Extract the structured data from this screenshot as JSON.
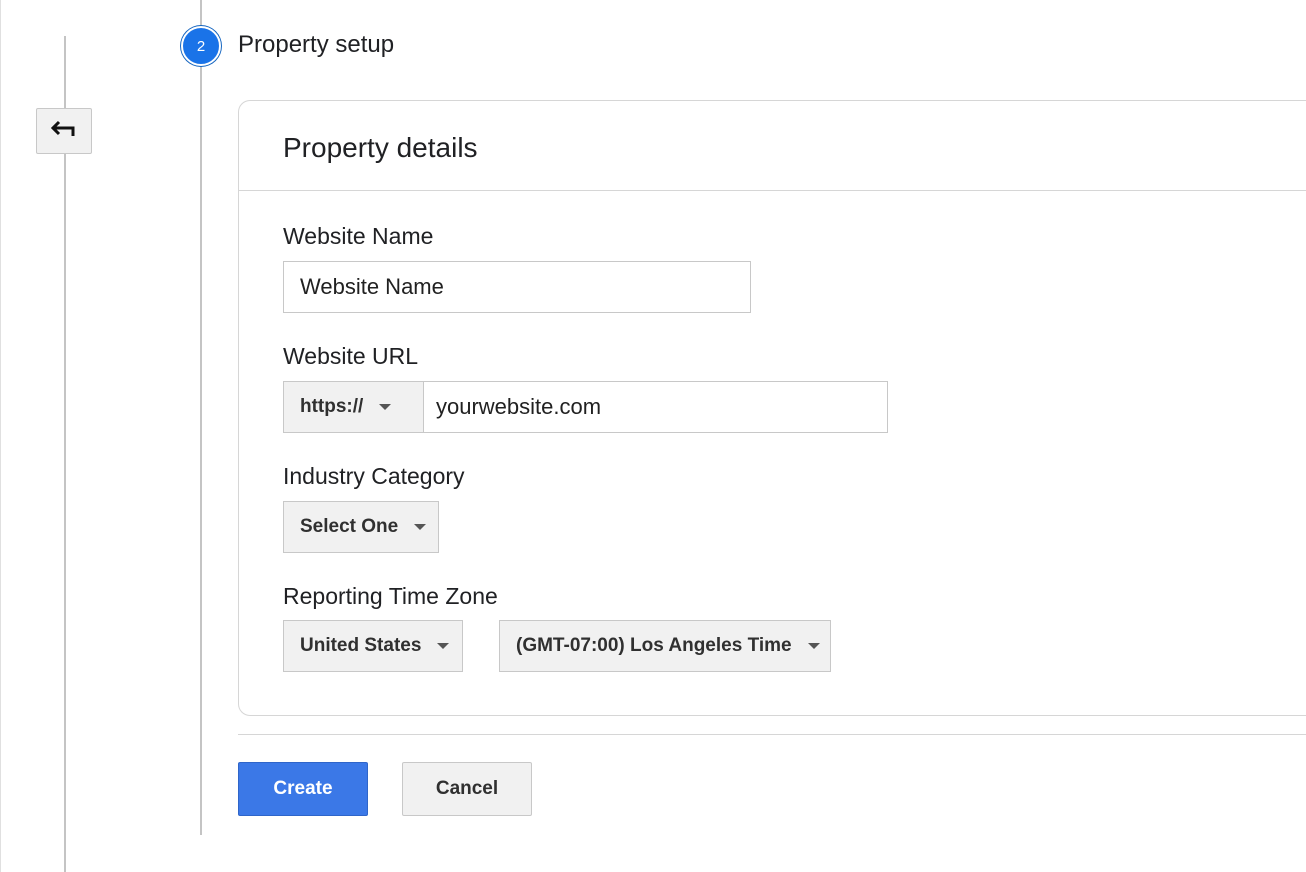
{
  "step": {
    "number": "2",
    "title": "Property setup"
  },
  "card": {
    "title": "Property details"
  },
  "fields": {
    "website_name": {
      "label": "Website Name",
      "placeholder": "Website Name"
    },
    "website_url": {
      "label": "Website URL",
      "protocol": "https://",
      "placeholder": "yourwebsite.com"
    },
    "industry_category": {
      "label": "Industry Category",
      "selected": "Select One"
    },
    "time_zone": {
      "label": "Reporting Time Zone",
      "country": "United States",
      "zone": "(GMT-07:00) Los Angeles Time"
    }
  },
  "actions": {
    "create_label": "Create",
    "cancel_label": "Cancel"
  },
  "icons": {
    "back": "back-arrow-icon",
    "dropdown": "chevron-down-icon"
  },
  "colors": {
    "primary": "#3b78e7",
    "step_badge": "#1a73e8"
  }
}
